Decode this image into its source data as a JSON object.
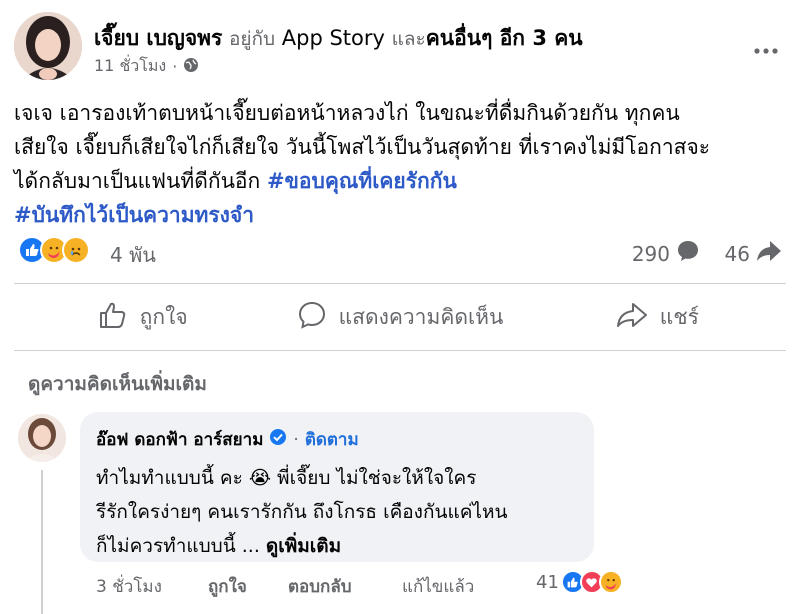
{
  "post": {
    "author": "เจี๊ยบ เบญจพร",
    "with_text": "อยู่กับ",
    "tagged_page": "App Story",
    "and_text": "และ",
    "others": "คนอื่นๆ อีก 3 คน",
    "time": "11 ชั่วโมง",
    "separator": "·",
    "privacy_icon": "globe-icon",
    "more_icon": "more-options-icon",
    "text_lines": [
      "เจเจ เอารองเท้าตบหน้าเจี๊ยบต่อหน้าหลวงไก่ ในขณะที่ดื่มกินด้วยกัน ทุกคน",
      "เสียใจ เจี๊ยบก็เสียใจไก่ก็เสียใจ วันนี้โพสไว้เป็นวันสุดท้าย ที่เราคงไม่มีโอกาสจะ",
      "ได้กลับมาเป็นแฟนที่ดีกันอีก"
    ],
    "hashtag_1": "#ขอบคุณที่เคยรักกัน",
    "hashtag_2": "#บันทึกไว้เป็นความทรงจำ"
  },
  "reactions": {
    "icons": [
      "like-reaction-icon",
      "care-reaction-icon",
      "sad-reaction-icon"
    ],
    "count": "4 พัน",
    "comments": "290",
    "shares": "46"
  },
  "actions": {
    "like": "ถูกใจ",
    "comment": "แสดงความคิดเห็น",
    "share": "แชร์"
  },
  "view_more_comments": "ดูความคิดเห็นเพิ่มเติม",
  "comment": {
    "author": "อ๊อฟ ดอกฟ้า อาร์สยาม",
    "verified_icon": "verified-badge-icon",
    "separator": "·",
    "follow": "ติดตาม",
    "lines": [
      "ทำไมทำแบบนี้ คะ 😭 พี่เจี๊ยบ ไม่ใช่จะให้ใจใคร",
      "รีรักใครง่ายๆ คนเรารักกัน ถึงโกรธ เคืองกันแค่ไหน"
    ],
    "last_line": "ก็ไม่ควรทำแบบนี้ ...",
    "see_more": "ดูเพิ่มเติม",
    "time": "3 ชั่วโมง",
    "like": "ถูกใจ",
    "reply": "ตอบกลับ",
    "edited": "แก้ไขแล้ว",
    "reaction_count": "41",
    "reaction_icons": [
      "like-reaction-icon",
      "love-reaction-icon",
      "care-reaction-icon"
    ]
  },
  "colors": {
    "text": "#050505",
    "muted": "#65676b",
    "hashtag": "#2d5ac7",
    "like_blue": "#1877f2",
    "love_red": "#f33e58",
    "bubble": "#f0f2f5"
  }
}
